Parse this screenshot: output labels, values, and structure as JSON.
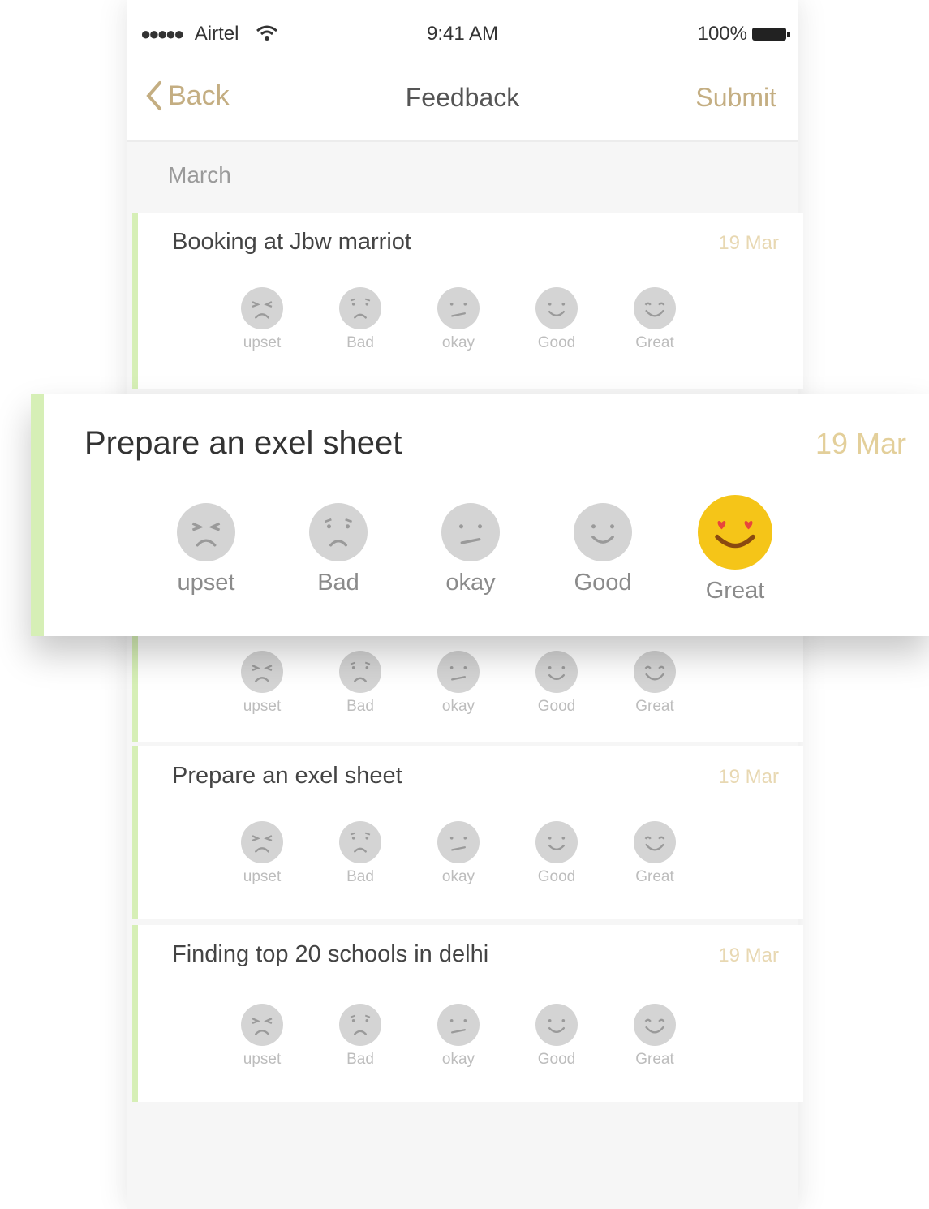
{
  "status": {
    "carrier": "Airtel",
    "time": "9:41 AM",
    "battery": "100%"
  },
  "nav": {
    "back": "Back",
    "title": "Feedback",
    "submit": "Submit"
  },
  "month": "March",
  "rating_labels": [
    "upset",
    "Bad",
    "okay",
    "Good",
    "Great"
  ],
  "cards": [
    {
      "title": "Booking at Jbw marriot",
      "date": "19 Mar",
      "selected": null
    },
    {
      "title": "",
      "date": "",
      "selected": null
    },
    {
      "title": "Prepare an exel sheet",
      "date": "19 Mar",
      "selected": null
    },
    {
      "title": "Finding top 20 schools in delhi",
      "date": "19 Mar",
      "selected": null
    }
  ],
  "overlay": {
    "title": "Prepare an exel sheet",
    "date": "19 Mar",
    "selected": "Great"
  },
  "colors": {
    "accent": "#c4ae82",
    "selected": "#f5c518",
    "bar": "#d6efb6"
  }
}
